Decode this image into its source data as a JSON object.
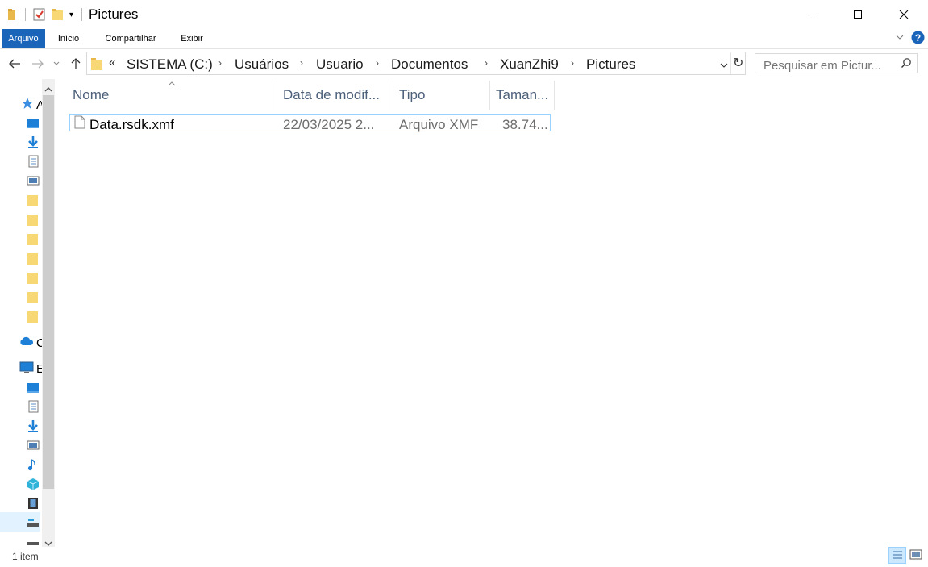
{
  "window": {
    "title": "Pictures"
  },
  "ribbon": {
    "tabs": [
      {
        "label": "Arquivo",
        "active": true
      },
      {
        "label": "Início"
      },
      {
        "label": "Compartilhar"
      },
      {
        "label": "Exibir"
      }
    ]
  },
  "address": {
    "overflow": "«",
    "crumbs": [
      "SISTEMA (C:)",
      "Usuários",
      "Usuario",
      "Documentos",
      "XuanZhi9",
      "Pictures"
    ]
  },
  "search": {
    "placeholder": "Pesquisar em Pictur..."
  },
  "columns": {
    "name": "Nome",
    "date": "Data de modif...",
    "type": "Tipo",
    "size": "Taman..."
  },
  "files": [
    {
      "name": "Data.rsdk.xmf",
      "date": "22/03/2025 2...",
      "type": "Arquivo XMF",
      "size": "38.74..."
    }
  ],
  "nav": {
    "quick_access_partial": "A",
    "onedrive_partial": "C",
    "thispc_partial": "E"
  },
  "status": {
    "count": "1 item"
  },
  "colors": {
    "accent": "#1a64b9",
    "selection_border": "#99d1ff",
    "header_text": "#4c607a",
    "cell_muted": "#6d6d6d"
  }
}
